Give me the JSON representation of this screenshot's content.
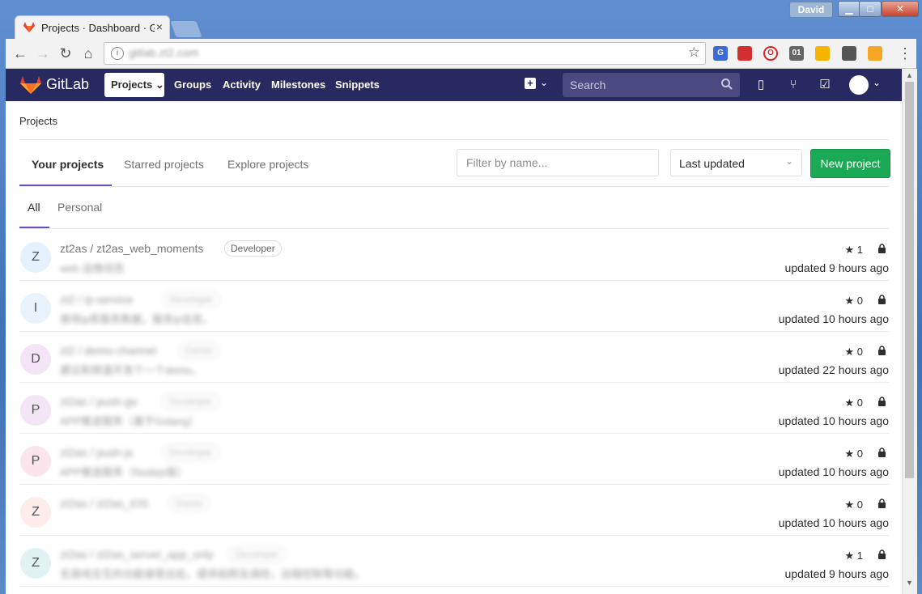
{
  "browser": {
    "tab_title": "Projects · Dashboard · G",
    "tab_close": "×",
    "user": "David",
    "url": "gitlab.zt2.com",
    "win_min": "▁",
    "win_max": "□",
    "win_close": "✕"
  },
  "gitlab": {
    "logo_text": "GitLab",
    "nav": {
      "projects": "Projects ⌄",
      "groups": "Groups",
      "activity": "Activity",
      "milestones": "Milestones",
      "snippets": "Snippets"
    },
    "search_placeholder": "Search"
  },
  "page": {
    "breadcrumb": "Projects",
    "tabs": [
      "Your projects",
      "Starred projects",
      "Explore projects"
    ],
    "filter_placeholder": "Filter by name...",
    "sort_value": "Last updated",
    "new_project": "New project",
    "subtabs": [
      "All",
      "Personal"
    ]
  },
  "projects": [
    {
      "initial": "Z",
      "name": "zt2as / zt2as_web_moments",
      "role": "Developer",
      "desc": "web 运维动态",
      "stars": "1",
      "updated": "updated 9 hours ago",
      "color": "#e3f2fd"
    },
    {
      "initial": "I",
      "name": "zt2 / ip-service",
      "role": "Developer",
      "desc": "使用ip库服务数据，服务ip信息。",
      "stars": "0",
      "updated": "updated 10 hours ago",
      "color": "#e8f3fc"
    },
    {
      "initial": "D",
      "name": "zt2 / demo-channel",
      "role": "Owner",
      "desc": "建议和频道开发个一个demo。",
      "stars": "0",
      "updated": "updated 22 hours ago",
      "color": "#f3e5f5"
    },
    {
      "initial": "P",
      "name": "zt2as / push-go",
      "role": "Developer",
      "desc": "APP推送服务（基于Golang）",
      "stars": "0",
      "updated": "updated 10 hours ago",
      "color": "#f3e5f5"
    },
    {
      "initial": "P",
      "name": "zt2as / push-js",
      "role": "Developer",
      "desc": "APP推送服务（Nodejs版）",
      "stars": "0",
      "updated": "updated 10 hours ago",
      "color": "#fce4ec"
    },
    {
      "initial": "Z",
      "name": "zt2as / zt2as_iOS",
      "role": "Owner",
      "desc": "",
      "stars": "0",
      "updated": "updated 10 hours ago",
      "color": "#fdecea"
    },
    {
      "initial": "Z",
      "name": "zt2as / zt2as_server_app_only",
      "role": "Developer",
      "desc": "无游戏交互的功能接受远处。提供拍照及调控，远程控制等功能。",
      "stars": "1",
      "updated": "updated 9 hours ago",
      "color": "#e0f2f1"
    }
  ]
}
